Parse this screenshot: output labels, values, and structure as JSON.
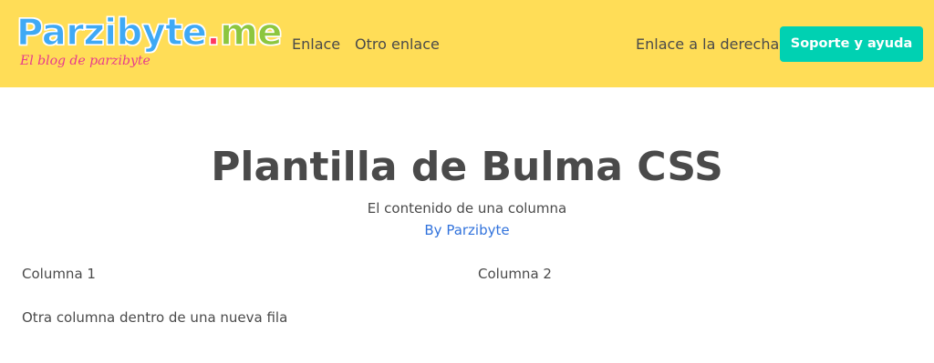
{
  "brand": {
    "logo_main": "Parzibyte",
    "logo_dot": ".",
    "logo_tld": "me",
    "tagline": "El blog de parzibyte"
  },
  "navbar": {
    "links_left": [
      "Enlace",
      "Otro enlace"
    ],
    "link_right": "Enlace a la derecha",
    "support_button": "Soporte y ayuda"
  },
  "hero": {
    "title": "Plantilla de Bulma CSS",
    "subtitle": "El contenido de una columna",
    "author_link": "By Parzibyte"
  },
  "columns": {
    "row1": [
      "Columna 1",
      "Columna 2"
    ],
    "row2": [
      "Otra columna dentro de una nueva fila"
    ]
  },
  "colors": {
    "navbar_background": "#ffdd57",
    "primary_button": "#00d1b2",
    "link": "#3273dc",
    "text": "#4a4a4a"
  }
}
